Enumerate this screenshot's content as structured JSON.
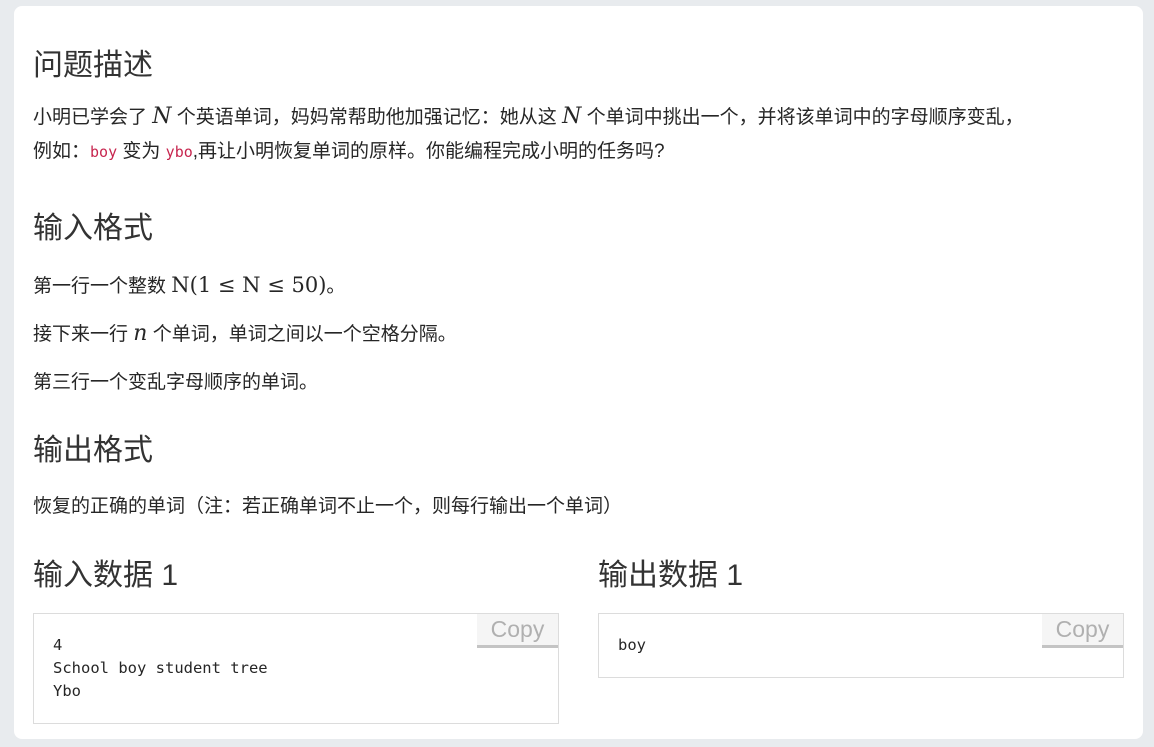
{
  "description": {
    "title": "问题描述",
    "line1": {
      "a": "小明已学会了 ",
      "n1": "N",
      "b": " 个英语单词，妈妈常帮助他加强记忆：她从这 ",
      "n2": "N",
      "c": " 个单词中挑出一个，并将该单词中的字母顺序变乱，"
    },
    "line2": {
      "a": "例如：",
      "code1": "boy",
      "b": " 变为 ",
      "code2": "ybo",
      "c": ",再让小明恢复单词的原样。你能编程完成小明的任务吗?"
    }
  },
  "input_format": {
    "title": "输入格式",
    "p1": {
      "a": "第一行一个整数 ",
      "math": "N(1 ≤ N ≤ 50)",
      "b": "。"
    },
    "p2": {
      "a": "接下来一行 ",
      "n": "n",
      "b": " 个单词，单词之间以一个空格分隔。"
    },
    "p3": "第三行一个变乱字母顺序的单词。"
  },
  "output_format": {
    "title": "输出格式",
    "p1": "恢复的正确的单词（注：若正确单词不止一个，则每行输出一个单词）"
  },
  "samples": {
    "input": {
      "title": "输入数据 1",
      "content": "4\nSchool boy student tree\nYbo",
      "copy_label": "Copy"
    },
    "output": {
      "title": "输出数据 1",
      "content": "boy",
      "copy_label": "Copy"
    }
  }
}
